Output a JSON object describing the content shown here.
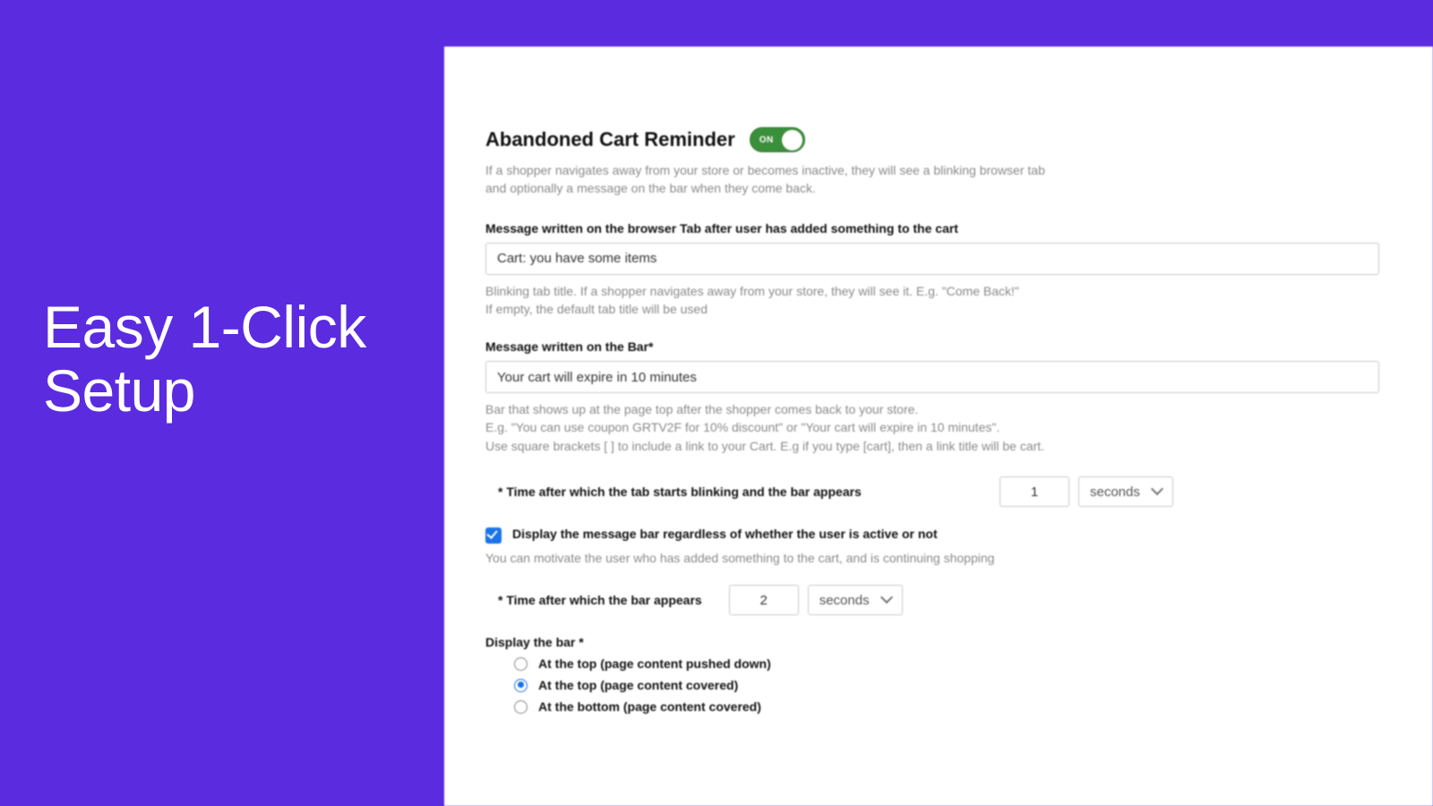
{
  "hero": {
    "line1": "Easy 1-Click",
    "line2": "Setup"
  },
  "section": {
    "title": "Abandoned Cart Reminder",
    "toggle_on_label": "ON",
    "intro_line1": "If a shopper navigates away from your store or becomes inactive, they will see a blinking browser tab",
    "intro_line2": "and optionally a message on the bar when they come back."
  },
  "tab_message": {
    "label": "Message written on the browser Tab after user has added something to the cart",
    "value": "Cart: you have some items",
    "help_line1": "Blinking tab title. If a shopper navigates away from your store, they will see it. E.g. \"Come Back!\"",
    "help_line2": "If empty, the default tab title will be used"
  },
  "bar_message": {
    "label": "Message written on the Bar*",
    "value": "Your cart will expire in 10 minutes",
    "help_line1": "Bar that shows up at the page top after the shopper comes back to your store.",
    "help_line2": "E.g. \"You can use coupon GRTV2F for 10% discount\" or \"Your cart will expire in 10 minutes\".",
    "help_line3": "Use square brackets [ ] to include a link to your Cart. E.g if you type [cart], then a link title will be cart."
  },
  "time_blink": {
    "label": "* Time after which the tab starts blinking and the bar appears",
    "value": "1",
    "unit": "seconds"
  },
  "always_display": {
    "label": "Display the message bar regardless of whether the user is active or not",
    "help": "You can motivate the user who has added something to the cart, and is continuing shopping"
  },
  "time_bar": {
    "label": "* Time after which the bar appears",
    "value": "2",
    "unit": "seconds"
  },
  "bar_position": {
    "label": "Display the bar *",
    "options": {
      "top_push": "At the top (page content pushed down)",
      "top_cover": "At the top (page content covered)",
      "bottom_cover": "At the bottom (page content covered)"
    }
  }
}
